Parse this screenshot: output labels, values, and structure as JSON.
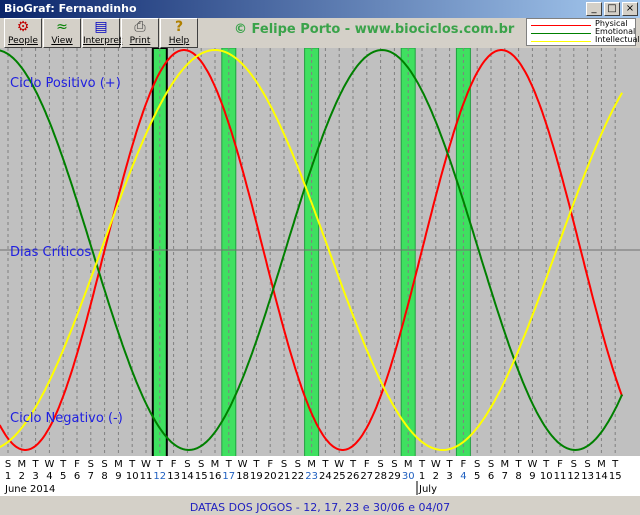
{
  "window": {
    "title": "BioGraf: Fernandinho"
  },
  "toolbar": [
    {
      "label": "People",
      "icon": "people-icon"
    },
    {
      "label": "View",
      "icon": "view-icon"
    },
    {
      "label": "Interpret",
      "icon": "interpret-icon"
    },
    {
      "label": "Print",
      "icon": "print-icon"
    },
    {
      "label": "Help",
      "icon": "help-icon"
    }
  ],
  "watermark": "© Felipe Porto - www.biociclos.com.br",
  "legend": [
    {
      "name": "Physical",
      "color": "#ff0000"
    },
    {
      "name": "Emotional",
      "color": "#008000"
    },
    {
      "name": "Intellectual",
      "color": "#ffff00"
    }
  ],
  "chart_labels": {
    "positive": "Ciclo Positivo (+)",
    "critical": "Dias Críticos",
    "negative": "Ciclo Negativo (-)"
  },
  "chart_data": {
    "type": "line",
    "days": [
      {
        "dow": "S",
        "day": "1"
      },
      {
        "dow": "M",
        "day": "2"
      },
      {
        "dow": "T",
        "day": "3"
      },
      {
        "dow": "W",
        "day": "4"
      },
      {
        "dow": "T",
        "day": "5"
      },
      {
        "dow": "F",
        "day": "6"
      },
      {
        "dow": "S",
        "day": "7"
      },
      {
        "dow": "S",
        "day": "8"
      },
      {
        "dow": "M",
        "day": "9"
      },
      {
        "dow": "T",
        "day": "10"
      },
      {
        "dow": "W",
        "day": "11"
      },
      {
        "dow": "T",
        "day": "12"
      },
      {
        "dow": "F",
        "day": "13"
      },
      {
        "dow": "S",
        "day": "14"
      },
      {
        "dow": "S",
        "day": "15"
      },
      {
        "dow": "M",
        "day": "16"
      },
      {
        "dow": "T",
        "day": "17"
      },
      {
        "dow": "W",
        "day": "18"
      },
      {
        "dow": "T",
        "day": "19"
      },
      {
        "dow": "F",
        "day": "20"
      },
      {
        "dow": "S",
        "day": "21"
      },
      {
        "dow": "S",
        "day": "22"
      },
      {
        "dow": "M",
        "day": "23"
      },
      {
        "dow": "T",
        "day": "24"
      },
      {
        "dow": "W",
        "day": "25"
      },
      {
        "dow": "T",
        "day": "26"
      },
      {
        "dow": "F",
        "day": "27"
      },
      {
        "dow": "S",
        "day": "28"
      },
      {
        "dow": "S",
        "day": "29"
      },
      {
        "dow": "M",
        "day": "30"
      },
      {
        "dow": "T",
        "day": "1"
      },
      {
        "dow": "W",
        "day": "2"
      },
      {
        "dow": "T",
        "day": "3"
      },
      {
        "dow": "F",
        "day": "4"
      },
      {
        "dow": "S",
        "day": "5"
      },
      {
        "dow": "S",
        "day": "6"
      },
      {
        "dow": "M",
        "day": "7"
      },
      {
        "dow": "T",
        "day": "8"
      },
      {
        "dow": "W",
        "day": "9"
      },
      {
        "dow": "T",
        "day": "10"
      },
      {
        "dow": "F",
        "day": "11"
      },
      {
        "dow": "S",
        "day": "12"
      },
      {
        "dow": "S",
        "day": "13"
      },
      {
        "dow": "M",
        "day": "14"
      },
      {
        "dow": "T",
        "day": "15"
      }
    ],
    "months": [
      {
        "label": "June 2014",
        "start_index": 0
      },
      {
        "label": "July",
        "start_index": 30
      }
    ],
    "highlighted_days": [
      11,
      16,
      22,
      29,
      33
    ],
    "series": [
      {
        "name": "Physical",
        "color": "#ff0000",
        "period": 23,
        "peak_index": 12.75
      },
      {
        "name": "Emotional",
        "color": "#008000",
        "period": 28,
        "peak_index": 27.1
      },
      {
        "name": "Intellectual",
        "color": "#ffff00",
        "period": 33,
        "peak_index": 15.0
      }
    ],
    "ylim": [
      -1,
      1
    ]
  },
  "status": {
    "text": "DATAS DOS JOGOS - 12, 17, 23 e 30/06 e 04/07"
  }
}
